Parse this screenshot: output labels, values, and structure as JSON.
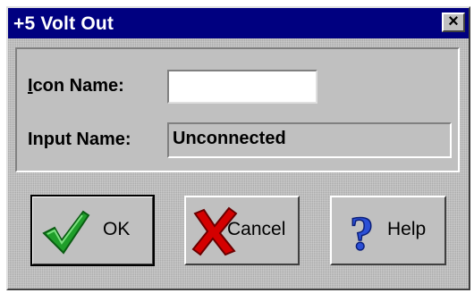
{
  "window": {
    "title": "+5 Volt Out",
    "close_glyph": "×"
  },
  "form": {
    "icon_name": {
      "label_prefix": "I",
      "label_rest": "con Name:",
      "value": ""
    },
    "input_name": {
      "label": "Input Name:",
      "value": "Unconnected"
    }
  },
  "buttons": {
    "ok": {
      "label": "OK",
      "icon": "checkmark-icon"
    },
    "cancel": {
      "label": "Cancel",
      "icon": "red-x-icon"
    },
    "help": {
      "label": "Help",
      "icon": "question-mark-icon"
    }
  },
  "colors": {
    "titlebar": "#000080",
    "face": "#c0c0c0",
    "check_green": "#1f9e2a",
    "x_red": "#d40000",
    "help_blue": "#2b4fd6"
  }
}
